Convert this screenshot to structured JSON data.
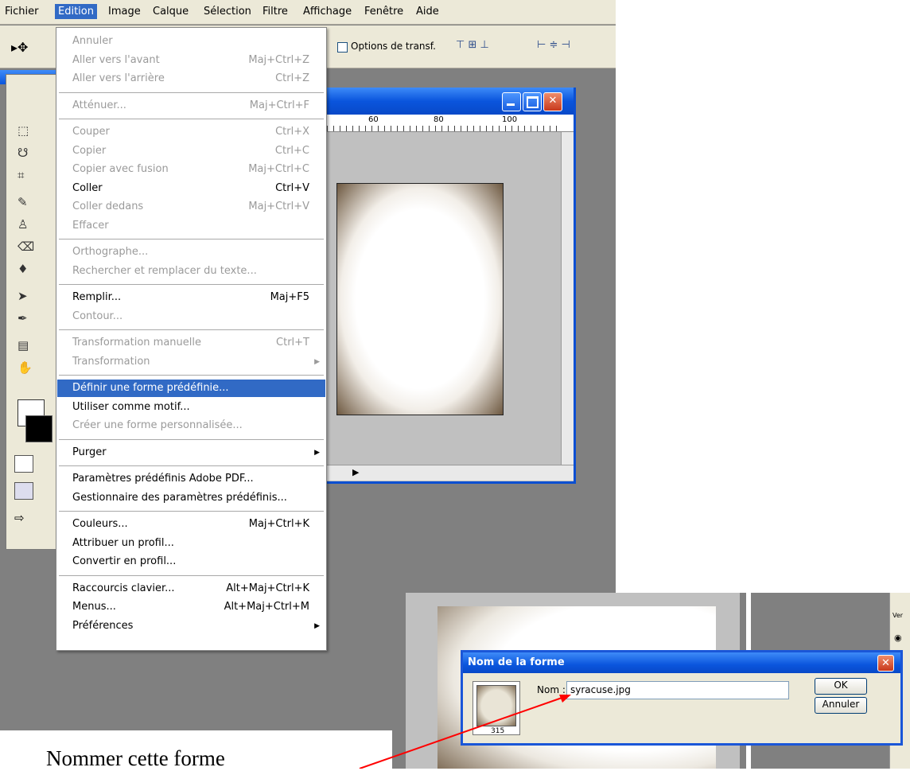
{
  "menubar": {
    "items": [
      "Fichier",
      "Edition",
      "Image",
      "Calque",
      "Sélection",
      "Filtre",
      "Affichage",
      "Fenêtre",
      "Aide"
    ]
  },
  "options_bar": {
    "transform_checkbox_label": "Options de transf.",
    "transform_checked": false
  },
  "document": {
    "ruler_labels": [
      "60",
      "80",
      "100"
    ]
  },
  "edit_menu": {
    "items": [
      {
        "label": "Annuler",
        "shortcut": "",
        "enabled": false
      },
      {
        "label": "Aller vers l'avant",
        "shortcut": "Maj+Ctrl+Z",
        "enabled": false
      },
      {
        "label": "Aller vers l'arrière",
        "shortcut": "Ctrl+Z",
        "enabled": false
      },
      {
        "label": "Atténuer...",
        "shortcut": "Maj+Ctrl+F",
        "enabled": false
      },
      {
        "label": "Couper",
        "shortcut": "Ctrl+X",
        "enabled": false
      },
      {
        "label": "Copier",
        "shortcut": "Ctrl+C",
        "enabled": false
      },
      {
        "label": "Copier avec fusion",
        "shortcut": "Maj+Ctrl+C",
        "enabled": false
      },
      {
        "label": "Coller",
        "shortcut": "Ctrl+V",
        "enabled": true
      },
      {
        "label": "Coller dedans",
        "shortcut": "Maj+Ctrl+V",
        "enabled": false
      },
      {
        "label": "Effacer",
        "shortcut": "",
        "enabled": false
      },
      {
        "label": "Orthographe...",
        "shortcut": "",
        "enabled": false
      },
      {
        "label": "Rechercher et remplacer du texte...",
        "shortcut": "",
        "enabled": false
      },
      {
        "label": "Remplir...",
        "shortcut": "Maj+F5",
        "enabled": true
      },
      {
        "label": "Contour...",
        "shortcut": "",
        "enabled": false
      },
      {
        "label": "Transformation manuelle",
        "shortcut": "Ctrl+T",
        "enabled": false
      },
      {
        "label": "Transformation",
        "shortcut": "",
        "enabled": false,
        "submenu": true
      },
      {
        "label": "Définir une forme prédéfinie...",
        "shortcut": "",
        "enabled": true,
        "highlighted": true
      },
      {
        "label": "Utiliser comme motif...",
        "shortcut": "",
        "enabled": true
      },
      {
        "label": "Créer une forme personnalisée...",
        "shortcut": "",
        "enabled": false
      },
      {
        "label": "Purger",
        "shortcut": "",
        "enabled": true,
        "submenu": true
      },
      {
        "label": "Paramètres prédéfinis Adobe PDF...",
        "shortcut": "",
        "enabled": true
      },
      {
        "label": "Gestionnaire des paramètres prédéfinis...",
        "shortcut": "",
        "enabled": true
      },
      {
        "label": "Couleurs...",
        "shortcut": "Maj+Ctrl+K",
        "enabled": true
      },
      {
        "label": "Attribuer un profil...",
        "shortcut": "",
        "enabled": true
      },
      {
        "label": "Convertir en profil...",
        "shortcut": "",
        "enabled": true
      },
      {
        "label": "Raccourcis clavier...",
        "shortcut": "Alt+Maj+Ctrl+K",
        "enabled": true
      },
      {
        "label": "Menus...",
        "shortcut": "Alt+Maj+Ctrl+M",
        "enabled": true
      },
      {
        "label": "Préférences",
        "shortcut": "",
        "enabled": true,
        "submenu": true
      }
    ]
  },
  "dialog": {
    "title": "Nom de la forme",
    "name_label": "Nom :",
    "name_value": "syracuse.jpg",
    "thumbnail_caption": "315",
    "ok_label": "OK",
    "cancel_label": "Annuler"
  },
  "lower_right_panel": {
    "text": "Ver"
  },
  "caption": {
    "text": "Nommer cette forme"
  },
  "colors": {
    "menu_highlight": "#316ac5",
    "xp_title_blue": "#0a55dd",
    "annotation_arrow": "#ff0000"
  }
}
